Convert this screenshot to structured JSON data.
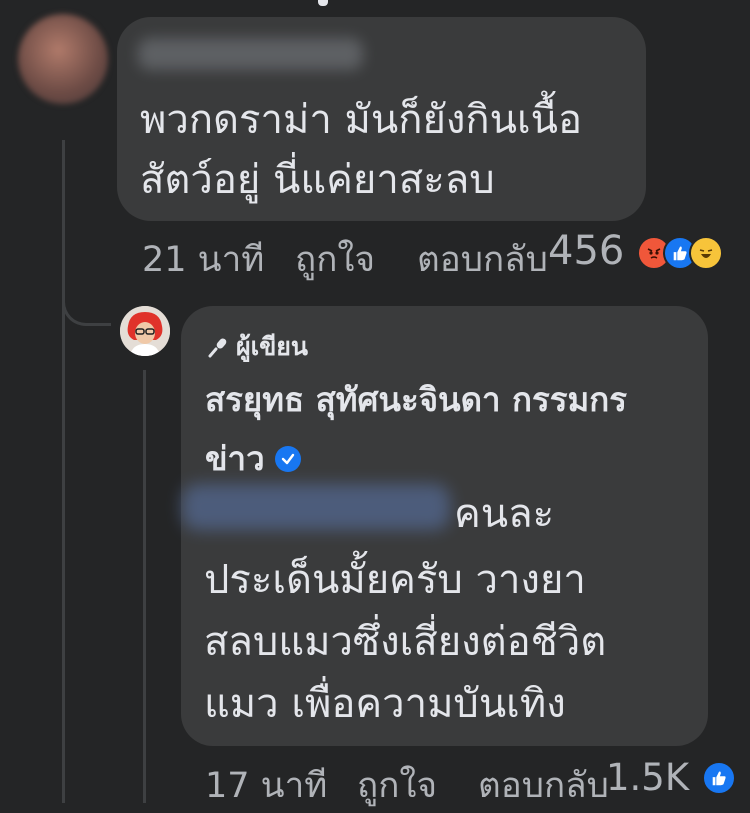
{
  "comment1": {
    "text_line1": "พวกดราม่า มันก็ยังกินเนื้อ",
    "text_line2": "สัตว์อยู่ นี่แค่ยาสะลบ",
    "time": "21 นาที",
    "like_label": "ถูกใจ",
    "reply_label": "ตอบกลับ",
    "reaction_count": "456",
    "reactions": [
      "angry-icon",
      "like-icon",
      "haha-icon"
    ]
  },
  "reply": {
    "author_badge": "ผู้เขียน",
    "author_name_line1": "สรยุทธ สุทัศนะจินดา กรรมกร",
    "author_name_line2": "ข่าว",
    "text_line1_suffix": "คนละ",
    "text_line2": "ประเด็นมั้ยครับ วางยา",
    "text_line3": "สลบแมวซึ่งเสี่ยงต่อชีวิต",
    "text_line4": "แมว เพื่อความบันเทิง",
    "time": "17 นาที",
    "like_label": "ถูกใจ",
    "reply_label": "ตอบกลับ",
    "reaction_count": "1.5K",
    "reactions": [
      "like-icon"
    ]
  },
  "colors": {
    "background": "#242526",
    "bubble": "#3a3b3c",
    "text": "#e4e6eb",
    "meta": "#b0b3b8",
    "like_blue": "#1877f2"
  }
}
